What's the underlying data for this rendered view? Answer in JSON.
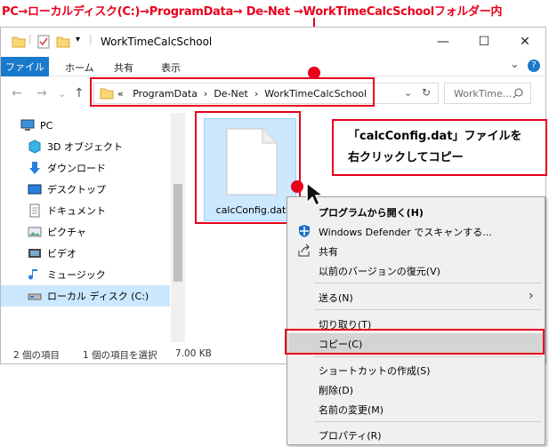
{
  "caption": "PC→ローカルディスク(C:)→ProgramData→ De-Net →WorkTimeCalcSchoolフォルダー内",
  "window": {
    "title": "WorkTimeCalcSchool",
    "minimize": "—",
    "maximize": "☐",
    "close": "✕"
  },
  "ribbon": {
    "file": "ファイル",
    "tabs": [
      "ホーム",
      "共有",
      "表示"
    ],
    "collapse": "⌄",
    "help": "?"
  },
  "address": {
    "overflow": "«",
    "crumbs": [
      "ProgramData",
      "De-Net",
      "WorkTimeCalcSchool"
    ],
    "separator": "›",
    "search_placeholder": "WorkTime...",
    "refresh": "↻",
    "dropdown": "⌄"
  },
  "nav": {
    "back": "←",
    "forward": "→",
    "recent": "⌄",
    "up": "↑"
  },
  "sidebar": {
    "items": [
      {
        "label": "PC",
        "icon": "pc-icon"
      },
      {
        "label": "3D オブジェクト",
        "icon": "3d-objects-icon"
      },
      {
        "label": "ダウンロード",
        "icon": "download-icon"
      },
      {
        "label": "デスクトップ",
        "icon": "desktop-icon"
      },
      {
        "label": "ドキュメント",
        "icon": "document-icon"
      },
      {
        "label": "ピクチャ",
        "icon": "pictures-icon"
      },
      {
        "label": "ビデオ",
        "icon": "video-icon"
      },
      {
        "label": "ミュージック",
        "icon": "music-icon"
      },
      {
        "label": "ローカル ディスク (C:)",
        "icon": "local-disk-icon"
      }
    ]
  },
  "file": {
    "name": "calcConfig.dat"
  },
  "status": {
    "count": "2 個の項目",
    "selected": "1 個の項目を選択",
    "size": "7.00 KB"
  },
  "callout": {
    "line1": "「calcConfig.dat」ファイルを",
    "line2": "右クリックしてコピー"
  },
  "context_menu": {
    "items": [
      {
        "label": "プログラムから開く(H)",
        "bold": true
      },
      {
        "label": "Windows Defender でスキャンする...",
        "icon": "defender-icon"
      },
      {
        "label": "共有",
        "icon": "share-icon"
      },
      {
        "label": "以前のバージョンの復元(V)"
      },
      {
        "label": "送る(N)",
        "submenu": "›"
      },
      {
        "label": "切り取り(T)"
      },
      {
        "label": "コピー(C)"
      },
      {
        "label": "ショートカットの作成(S)"
      },
      {
        "label": "削除(D)"
      },
      {
        "label": "名前の変更(M)"
      },
      {
        "label": "プロパティ(R)"
      }
    ]
  },
  "colors": {
    "accent_red": "#e8001c",
    "ribbon_blue": "#1979ca",
    "selection": "#cce8ff"
  }
}
